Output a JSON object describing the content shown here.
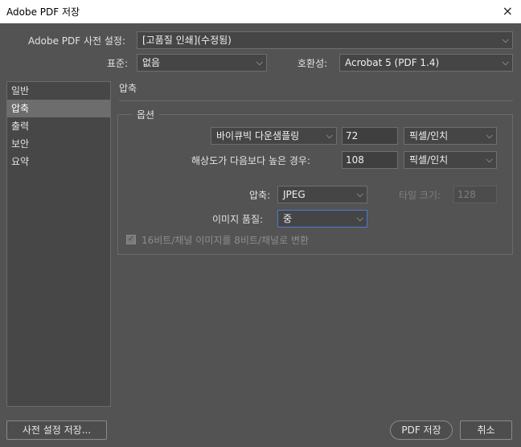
{
  "window": {
    "title": "Adobe PDF 저장",
    "close_icon": "×"
  },
  "preset": {
    "label": "Adobe PDF 사전 설정:",
    "value": "[고품질 인쇄](수정됨)"
  },
  "standard": {
    "label": "표준:",
    "value": "없음"
  },
  "compatibility": {
    "label": "호환성:",
    "value": "Acrobat 5 (PDF 1.4)"
  },
  "sidebar": {
    "items": [
      "일반",
      "압축",
      "출력",
      "보안",
      "요약"
    ],
    "selected_index": 1
  },
  "section": {
    "title": "압축"
  },
  "options": {
    "legend": "옵션",
    "resample_method": "바이큐빅 다운샘플링",
    "resample_ppi": "72",
    "resample_unit": "픽셀/인치",
    "above_label": "해상도가 다음보다 높은 경우:",
    "above_ppi": "108",
    "above_unit": "픽셀/인치",
    "compression_label": "압축:",
    "compression_value": "JPEG",
    "tile_label": "타일 크기:",
    "tile_value": "128",
    "quality_label": "이미지 품질:",
    "quality_value": "중",
    "convert_label": "16비트/채널 이미지를 8비트/채널로 변환",
    "convert_checked": true
  },
  "buttons": {
    "save_preset": "사전 설정 저장...",
    "save_pdf": "PDF 저장",
    "cancel": "취소"
  },
  "chevron": "⌵"
}
